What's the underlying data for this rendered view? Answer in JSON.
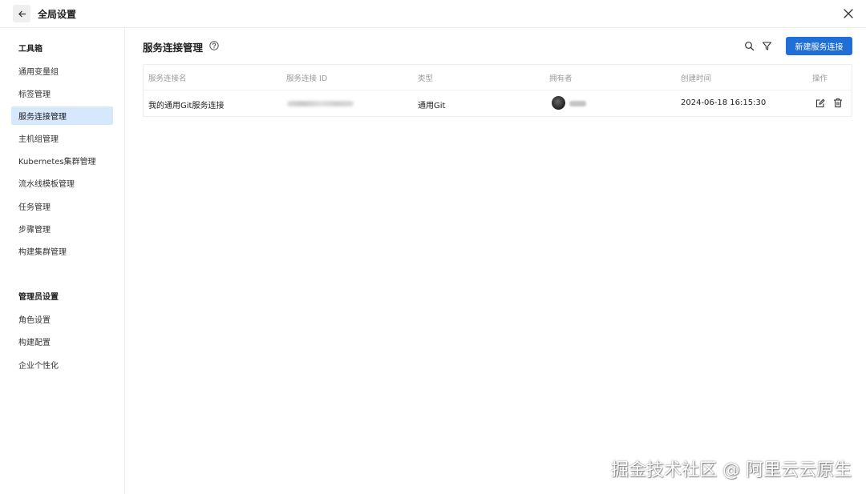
{
  "header": {
    "title": "全局设置",
    "back_icon": "arrow-left-icon",
    "close_icon": "close-icon"
  },
  "sidebar": {
    "group1_title": "工具箱",
    "group1_items": [
      {
        "label": "通用变量组",
        "active": false
      },
      {
        "label": "标签管理",
        "active": false
      },
      {
        "label": "服务连接管理",
        "active": true
      },
      {
        "label": "主机组管理",
        "active": false
      },
      {
        "label": "Kubernetes集群管理",
        "active": false
      },
      {
        "label": "流水线模板管理",
        "active": false
      },
      {
        "label": "任务管理",
        "active": false
      },
      {
        "label": "步骤管理",
        "active": false
      },
      {
        "label": "构建集群管理",
        "active": false
      }
    ],
    "group2_title": "管理员设置",
    "group2_items": [
      {
        "label": "角色设置",
        "active": false
      },
      {
        "label": "构建配置",
        "active": false
      },
      {
        "label": "企业个性化",
        "active": false
      }
    ]
  },
  "main": {
    "title": "服务连接管理",
    "new_button_label": "新建服务连接",
    "accent_color": "#1f6fd6",
    "table": {
      "columns": [
        "服务连接名",
        "服务连接 ID",
        "类型",
        "拥有者",
        "创建时间",
        "操作"
      ],
      "rows": [
        {
          "name": "我的通用Git服务连接",
          "id": "",
          "type": "通用Git",
          "owner": "",
          "created_at": "2024-06-18 16:15:30"
        }
      ]
    }
  },
  "watermark": "掘金技术社区 @ 阿里云云原生"
}
